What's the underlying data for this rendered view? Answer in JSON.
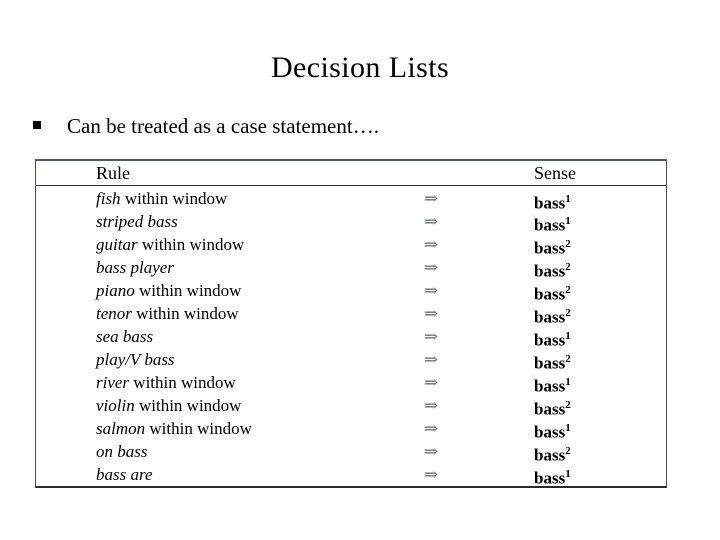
{
  "slide": {
    "title": "Decision Lists",
    "bullet": {
      "marker": "square-bullet",
      "text": "Can be treated as a case statement…."
    },
    "table": {
      "headers": {
        "rule": "Rule",
        "sense": "Sense"
      },
      "arrow_glyph": "⇒",
      "rows": [
        {
          "keyword": "fish",
          "rest": " within window",
          "arrow": "⇒",
          "sense": "bass",
          "sense_superscript": "1"
        },
        {
          "keyword": "striped bass",
          "rest": "",
          "arrow": "⇒",
          "sense": "bass",
          "sense_superscript": "1"
        },
        {
          "keyword": "guitar",
          "rest": " within window",
          "arrow": "⇒",
          "sense": "bass",
          "sense_superscript": "2"
        },
        {
          "keyword": "bass player",
          "rest": "",
          "arrow": "⇒",
          "sense": "bass",
          "sense_superscript": "2"
        },
        {
          "keyword": "piano",
          "rest": " within window",
          "arrow": "⇒",
          "sense": "bass",
          "sense_superscript": "2"
        },
        {
          "keyword": "tenor",
          "rest": " within window",
          "arrow": "⇒",
          "sense": "bass",
          "sense_superscript": "2"
        },
        {
          "keyword": "sea bass",
          "rest": "",
          "arrow": "⇒",
          "sense": "bass",
          "sense_superscript": "1"
        },
        {
          "keyword": "play/V bass",
          "rest": "",
          "arrow": "⇒",
          "sense": "bass",
          "sense_superscript": "2"
        },
        {
          "keyword": "river",
          "rest": " within window",
          "arrow": "⇒",
          "sense": "bass",
          "sense_superscript": "1"
        },
        {
          "keyword": "violin",
          "rest": " within window",
          "arrow": "⇒",
          "sense": "bass",
          "sense_superscript": "2"
        },
        {
          "keyword": "salmon",
          "rest": " within window",
          "arrow": "⇒",
          "sense": "bass",
          "sense_superscript": "1"
        },
        {
          "keyword": "on bass",
          "rest": "",
          "arrow": "⇒",
          "sense": "bass",
          "sense_superscript": "2"
        },
        {
          "keyword": "bass are",
          "rest": "",
          "arrow": "⇒",
          "sense": "bass",
          "sense_superscript": "1"
        }
      ]
    }
  }
}
